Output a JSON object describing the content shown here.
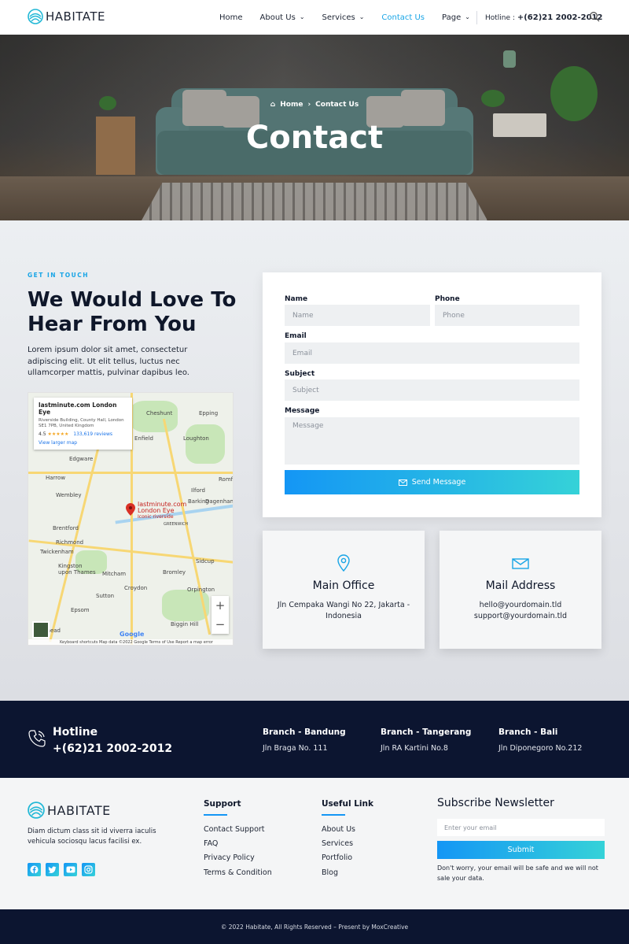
{
  "header": {
    "logo_text": "HABITATE",
    "nav": [
      {
        "label": "Home",
        "dropdown": false,
        "active": false
      },
      {
        "label": "About Us",
        "dropdown": true,
        "active": false
      },
      {
        "label": "Services",
        "dropdown": true,
        "active": false
      },
      {
        "label": "Contact Us",
        "dropdown": false,
        "active": true
      },
      {
        "label": "Page",
        "dropdown": true,
        "active": false
      }
    ],
    "hotline_label": "Hotline :",
    "hotline_number": "+(62)21 2002-2012",
    "search_icon": "search-icon"
  },
  "hero": {
    "breadcrumb_home": "Home",
    "breadcrumb_current": "Contact Us",
    "title": "Contact"
  },
  "contact": {
    "eyebrow": "GET IN TOUCH",
    "heading": "We Would Love To Hear From You",
    "description": "Lorem ipsum dolor sit amet, consectetur adipiscing elit. Ut elit tellus, luctus nec ullamcorper mattis, pulvinar dapibus leo.",
    "map": {
      "place_name": "lastminute.com London Eye",
      "address": "Riverside Building, County Hall, London SE1 7PB, United Kingdom",
      "rating": "4.5",
      "stars": "★★★★★",
      "reviews": "133,619 reviews",
      "larger_map": "View larger map",
      "pin_label": "lastminute.com London Eye",
      "pin_sublabel": "Iconic riverside",
      "labels": [
        "Cheshunt",
        "Epping",
        "Enfield",
        "Loughton",
        "Edgware",
        "Harrow",
        "Wembley",
        "Romf",
        "Ilford",
        "Barking",
        "Dagenham",
        "Brentford",
        "Richmond",
        "Twickenham",
        "Kingston upon Thames",
        "Mitcham",
        "Bromley",
        "Sidcup",
        "Croydon",
        "Orpington",
        "Sutton",
        "Epsom",
        "Ilherhead",
        "Biggin Hill",
        "GREENWICH"
      ],
      "zoom_in": "+",
      "zoom_out": "−",
      "google": "Google",
      "footer_items": "Keyboard shortcuts    Map data ©2022 Google    Terms of Use    Report a map error"
    },
    "form": {
      "name_label": "Name",
      "name_placeholder": "Name",
      "phone_label": "Phone",
      "phone_placeholder": "Phone",
      "email_label": "Email",
      "email_placeholder": "Email",
      "subject_label": "Subject",
      "subject_placeholder": "Subject",
      "message_label": "Message",
      "message_placeholder": "Message",
      "send_label": "Send Message"
    },
    "cards": [
      {
        "icon": "map-pin-icon",
        "title": "Main Office",
        "text": "Jln Cempaka Wangi No 22, Jakarta - Indonesia"
      },
      {
        "icon": "envelope-icon",
        "title": "Mail Address",
        "text": "hello@yourdomain.tld support@yourdomain.tld"
      }
    ]
  },
  "band": {
    "hotline_label": "Hotline",
    "hotline_number": "+(62)21 2002-2012",
    "branches": [
      {
        "name": "Branch - Bandung",
        "address": "Jln Braga No. 111"
      },
      {
        "name": "Branch - Tangerang",
        "address": "Jln RA Kartini No.8"
      },
      {
        "name": "Branch - Bali",
        "address": "Jln Diponegoro No.212"
      }
    ]
  },
  "footer": {
    "logo_text": "HABITATE",
    "about": "Diam dictum class sit id viverra iaculis vehicula sociosqu lacus facilisi ex.",
    "socials": [
      "facebook-icon",
      "twitter-icon",
      "youtube-icon",
      "instagram-icon"
    ],
    "support_title": "Support",
    "support_links": [
      "Contact Support",
      "FAQ",
      "Privacy Policy",
      "Terms & Condition"
    ],
    "useful_title": "Useful Link",
    "useful_links": [
      "About Us",
      "Services",
      "Portfolio",
      "Blog"
    ],
    "newsletter_title": "Subscribe Newsletter",
    "newsletter_placeholder": "Enter your email",
    "newsletter_button": "Submit",
    "newsletter_note": "Don't worry, your email will be safe and we will not sale your data.",
    "copyright": "© 2022 Habitate, All Rights Reserved – Present by MoxCreative"
  },
  "colors": {
    "accent": "#19a5e6",
    "gradient_start": "#1496f5",
    "gradient_end": "#35d2d8",
    "dark": "#0c1530"
  }
}
